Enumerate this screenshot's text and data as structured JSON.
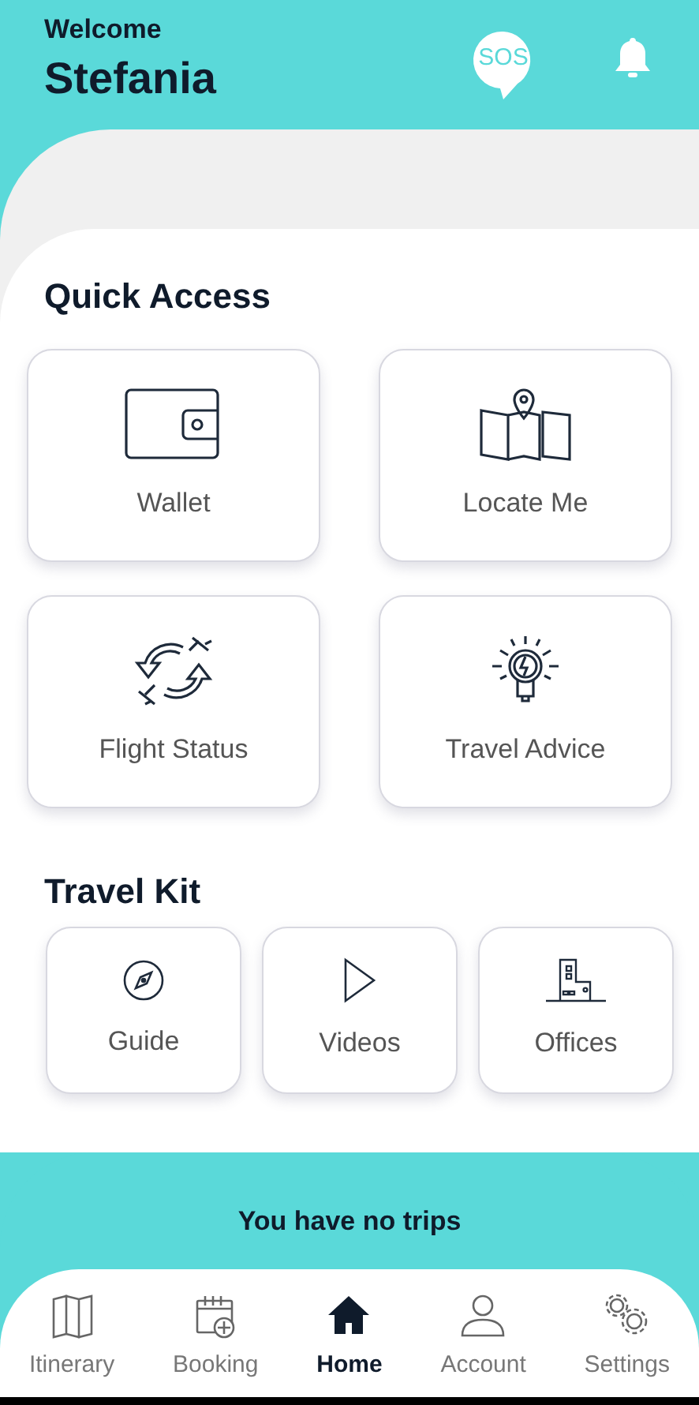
{
  "header": {
    "greeting": "Welcome",
    "name": "Stefania",
    "sos_label": "SOS"
  },
  "quick_access": {
    "title": "Quick Access",
    "items": [
      {
        "label": "Wallet"
      },
      {
        "label": "Locate Me"
      },
      {
        "label": "Flight Status"
      },
      {
        "label": "Travel Advice"
      }
    ]
  },
  "travel_kit": {
    "title": "Travel Kit",
    "items": [
      {
        "label": "Guide"
      },
      {
        "label": "Videos"
      },
      {
        "label": "Offices"
      }
    ]
  },
  "trips": {
    "message": "You have no trips"
  },
  "bottom_nav": [
    {
      "label": "Itinerary",
      "selected": false
    },
    {
      "label": "Booking",
      "selected": false
    },
    {
      "label": "Home",
      "selected": true
    },
    {
      "label": "Account",
      "selected": false
    },
    {
      "label": "Settings",
      "selected": false
    }
  ]
}
